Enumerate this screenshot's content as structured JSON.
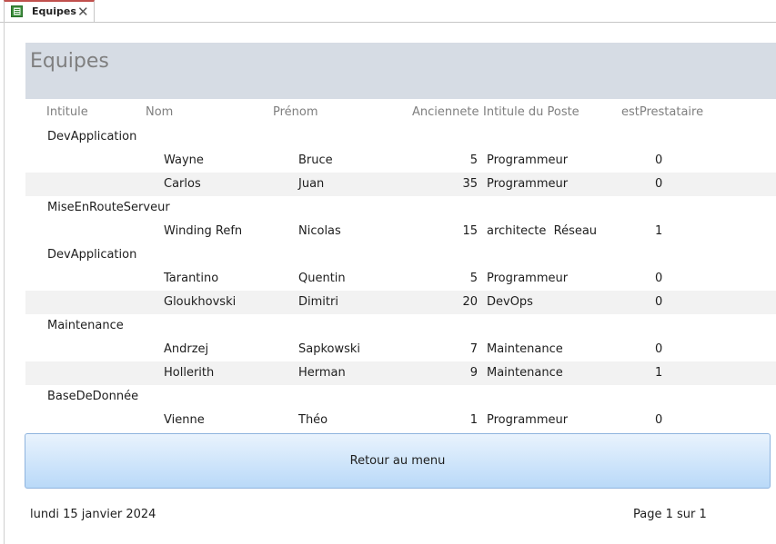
{
  "tab": {
    "label": "Equipes"
  },
  "report": {
    "title": "Equipes",
    "columns": {
      "intitule": "Intitule",
      "nom": "Nom",
      "prenom": "Prénom",
      "anciennete": "Anciennete",
      "poste": "Intitule du Poste",
      "prestataire": "estPrestataire"
    },
    "rows": [
      {
        "group": "DevApplication"
      },
      {
        "nom": "Wayne",
        "prenom": "Bruce",
        "anciennete": "5",
        "poste": "Programmeur",
        "prestataire": "0"
      },
      {
        "nom": "Carlos",
        "prenom": "Juan",
        "anciennete": "35",
        "poste": "Programmeur",
        "prestataire": "0"
      },
      {
        "group": "MiseEnRouteServeur"
      },
      {
        "nom": "Winding Refn",
        "prenom": "Nicolas",
        "anciennete": "15",
        "poste": "architecte  Réseau",
        "prestataire": "1"
      },
      {
        "group": "DevApplication"
      },
      {
        "nom": "Tarantino",
        "prenom": "Quentin",
        "anciennete": "5",
        "poste": "Programmeur",
        "prestataire": "0"
      },
      {
        "nom": "Gloukhovski",
        "prenom": "Dimitri",
        "anciennete": "20",
        "poste": "DevOps",
        "prestataire": "0"
      },
      {
        "group": "Maintenance"
      },
      {
        "nom": "Andrzej",
        "prenom": "Sapkowski",
        "anciennete": "7",
        "poste": "Maintenance",
        "prestataire": "0"
      },
      {
        "nom": "Hollerith",
        "prenom": "Herman",
        "anciennete": "9",
        "poste": "Maintenance",
        "prestataire": "1"
      },
      {
        "group": "BaseDeDonnée"
      },
      {
        "nom": "Vienne",
        "prenom": "Théo",
        "anciennete": "1",
        "poste": "Programmeur",
        "prestataire": "0"
      }
    ]
  },
  "button": {
    "label": "Retour au menu"
  },
  "footer": {
    "date": "lundi 15 janvier 2024",
    "page": "Page 1 sur 1"
  }
}
